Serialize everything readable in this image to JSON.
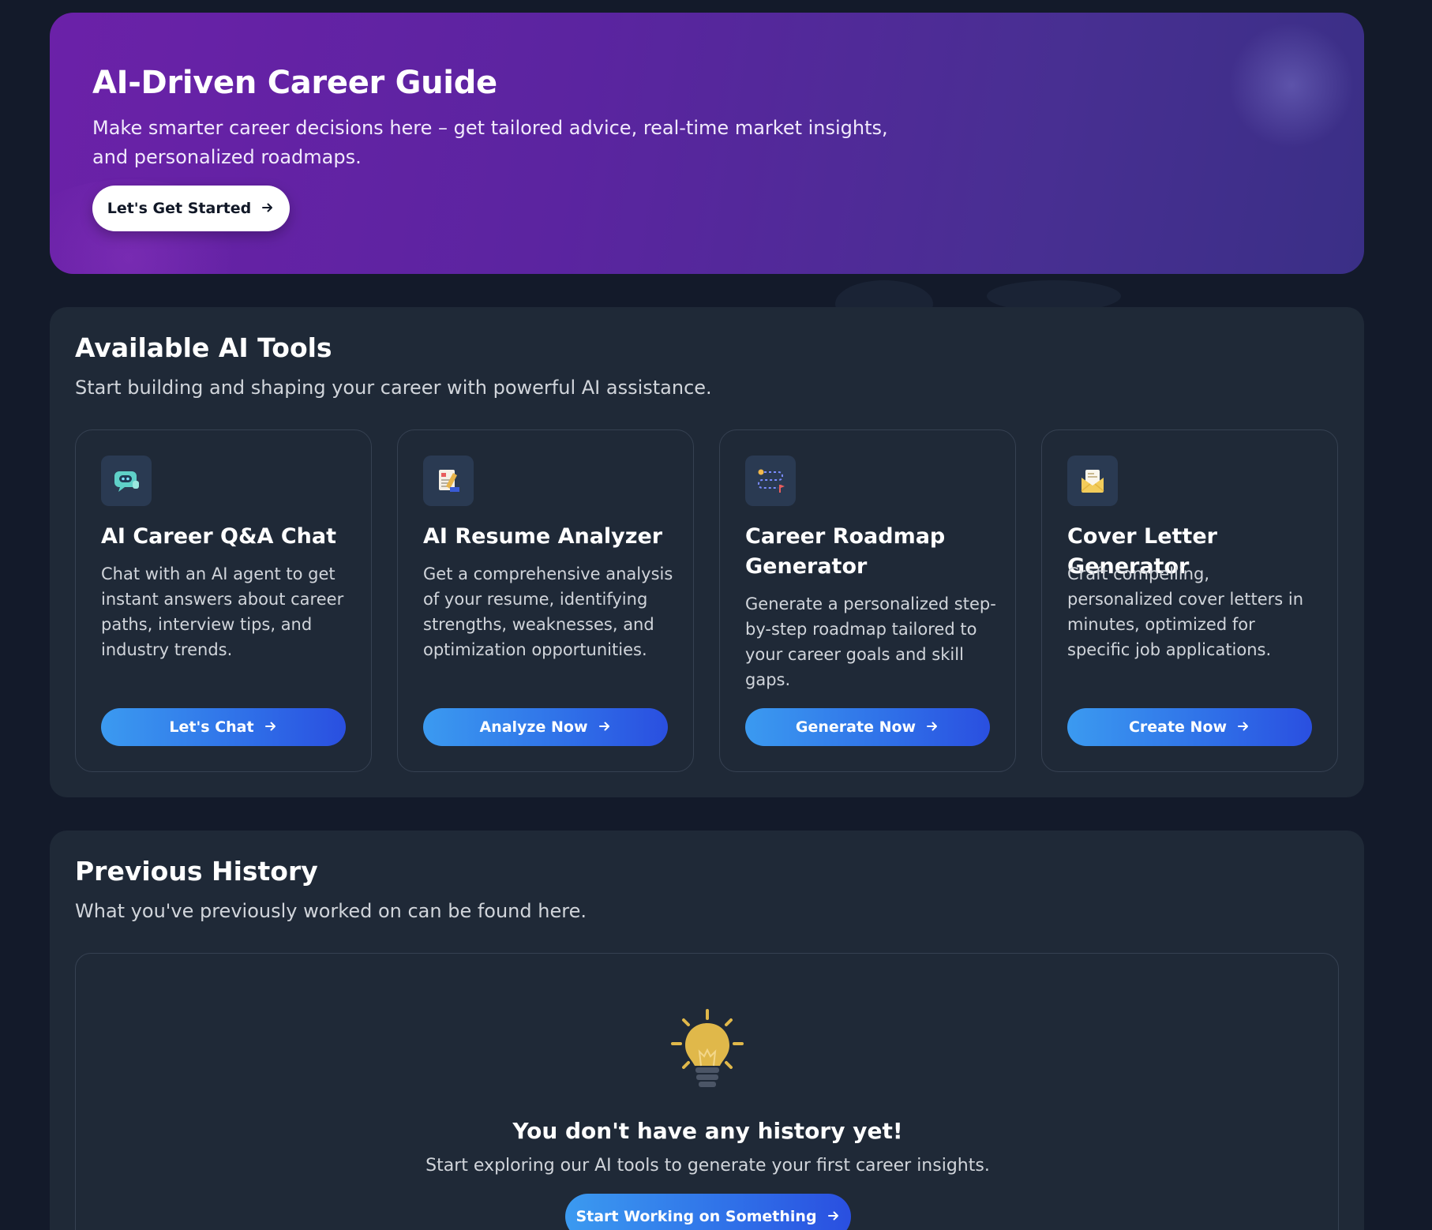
{
  "hero": {
    "title": "AI-Driven Career Guide",
    "subtitle": "Make smarter career decisions here – get tailored advice, real-time market insights, and personalized roadmaps.",
    "button_label": "Let's Get Started",
    "arrow_icon": "arrow-right-icon"
  },
  "tools": {
    "title": "Available AI Tools",
    "subtitle": "Start building and shaping your career with powerful AI assistance.",
    "cards": [
      {
        "icon": "chat-bot-icon",
        "title": "AI Career Q&A Chat",
        "description": "Chat with an AI agent to get instant answers about career paths, interview tips, and industry trends.",
        "button_label": "Let's Chat"
      },
      {
        "icon": "resume-document-icon",
        "title": "AI Resume Analyzer",
        "description": "Get a comprehensive analysis of your resume, identifying strengths, weaknesses, and optimization opportunities.",
        "button_label": "Analyze Now"
      },
      {
        "icon": "roadmap-path-icon",
        "title": "Career Roadmap Generator",
        "description": "Generate a personalized step-by-step roadmap tailored to your career goals and skill gaps.",
        "button_label": "Generate Now"
      },
      {
        "icon": "envelope-letter-icon",
        "title": "Cover Letter Generator",
        "description": "Craft compelling, personalized cover letters in minutes, optimized for specific job applications.",
        "button_label": "Create Now"
      }
    ]
  },
  "history": {
    "title": "Previous History",
    "subtitle": "What you've previously worked on can be found here.",
    "empty_icon": "lightbulb-icon",
    "empty_title": "You don't have any history yet!",
    "empty_subtitle": "Start exploring our AI tools to generate your first career insights.",
    "empty_button_label": "Start Working on Something"
  },
  "colors": {
    "background": "#131a2a",
    "panel": "#1f2937",
    "hero_start": "#6b21a8",
    "hero_end": "#3a2f86",
    "button_blue": "#3b82f6",
    "bulb_yellow": "#e0b84a"
  }
}
